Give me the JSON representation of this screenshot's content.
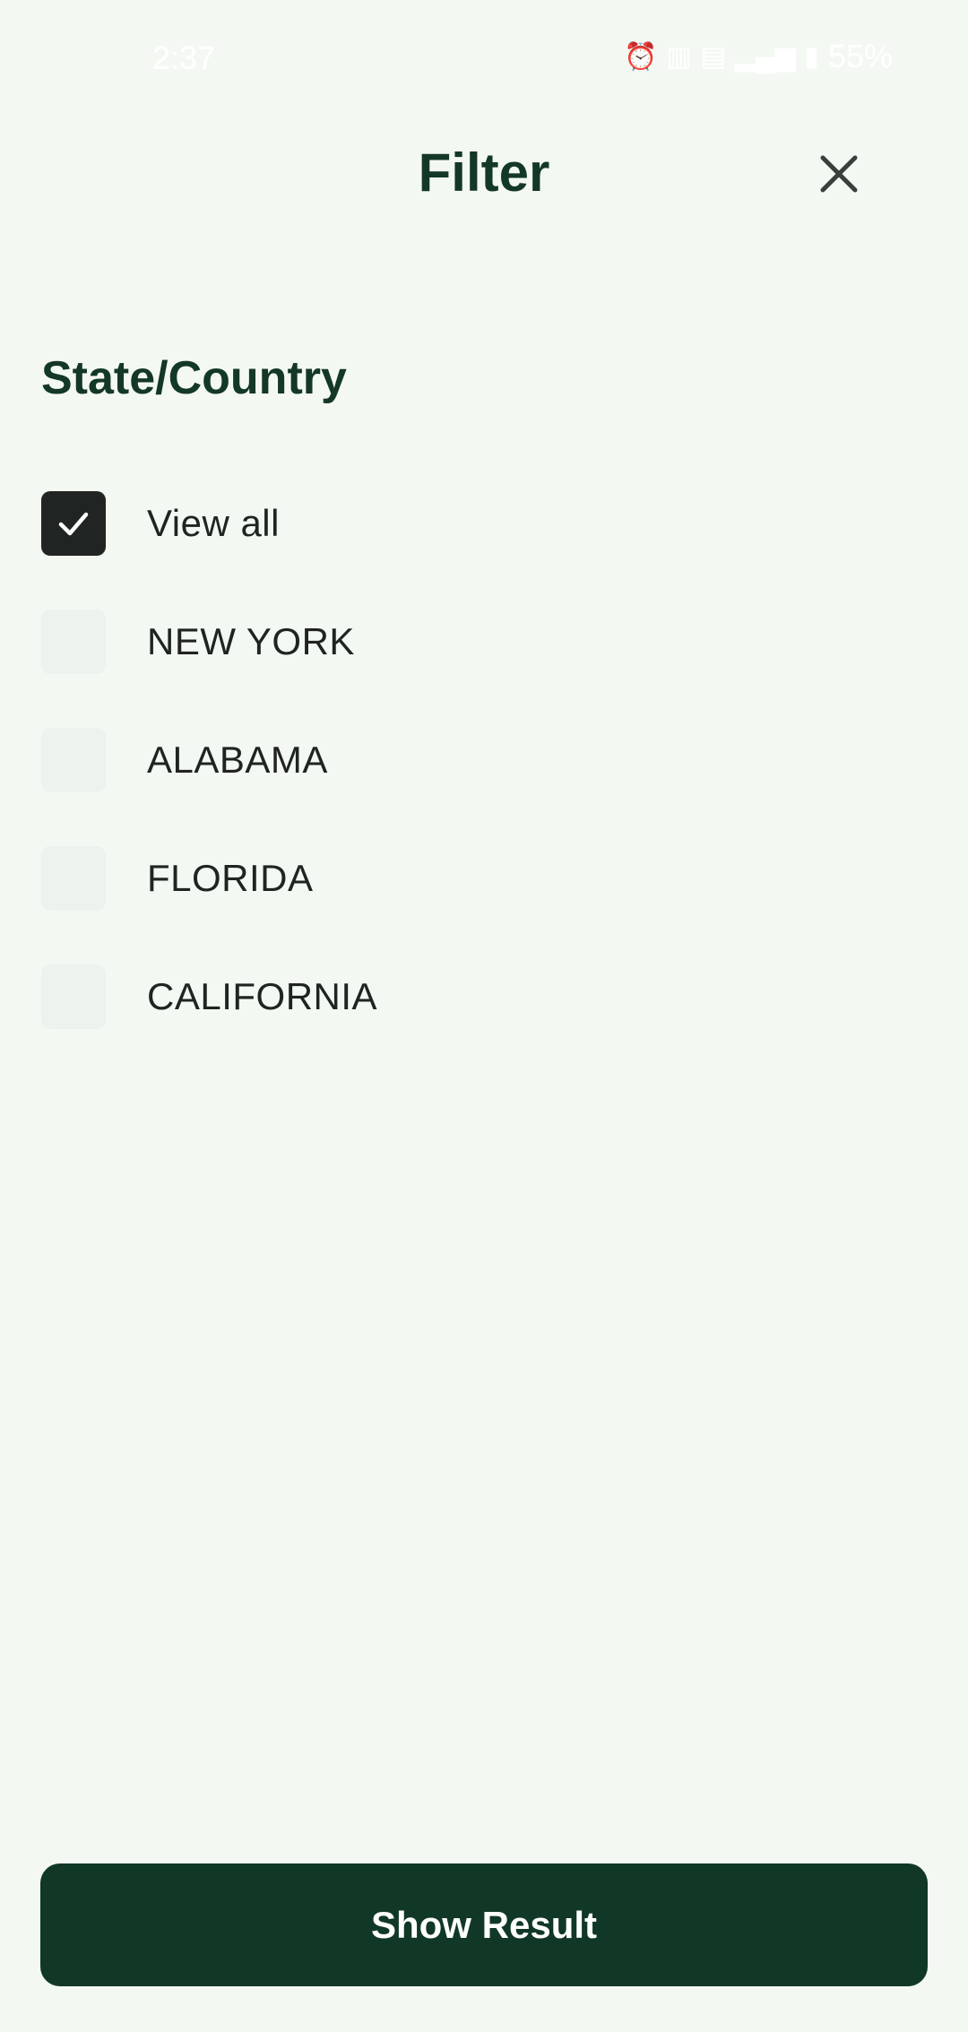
{
  "status_bar": {
    "time": "2:37",
    "battery": "55%",
    "icons": [
      "alarm-icon",
      "sim-icon",
      "wifi-calling-icon",
      "signal-icon",
      "battery-icon"
    ]
  },
  "header": {
    "title": "Filter",
    "close_icon": "close-icon"
  },
  "section": {
    "title": "State/Country",
    "options": [
      {
        "label": "View all",
        "checked": true
      },
      {
        "label": "NEW YORK",
        "checked": false
      },
      {
        "label": "ALABAMA",
        "checked": false
      },
      {
        "label": "FLORIDA",
        "checked": false
      },
      {
        "label": "CALIFORNIA",
        "checked": false
      }
    ]
  },
  "footer": {
    "button_label": "Show Result"
  },
  "colors": {
    "background": "#f4f8f3",
    "primary": "#113826",
    "checkbox_checked": "#202423",
    "checkbox_unchecked": "#eef2ee"
  }
}
